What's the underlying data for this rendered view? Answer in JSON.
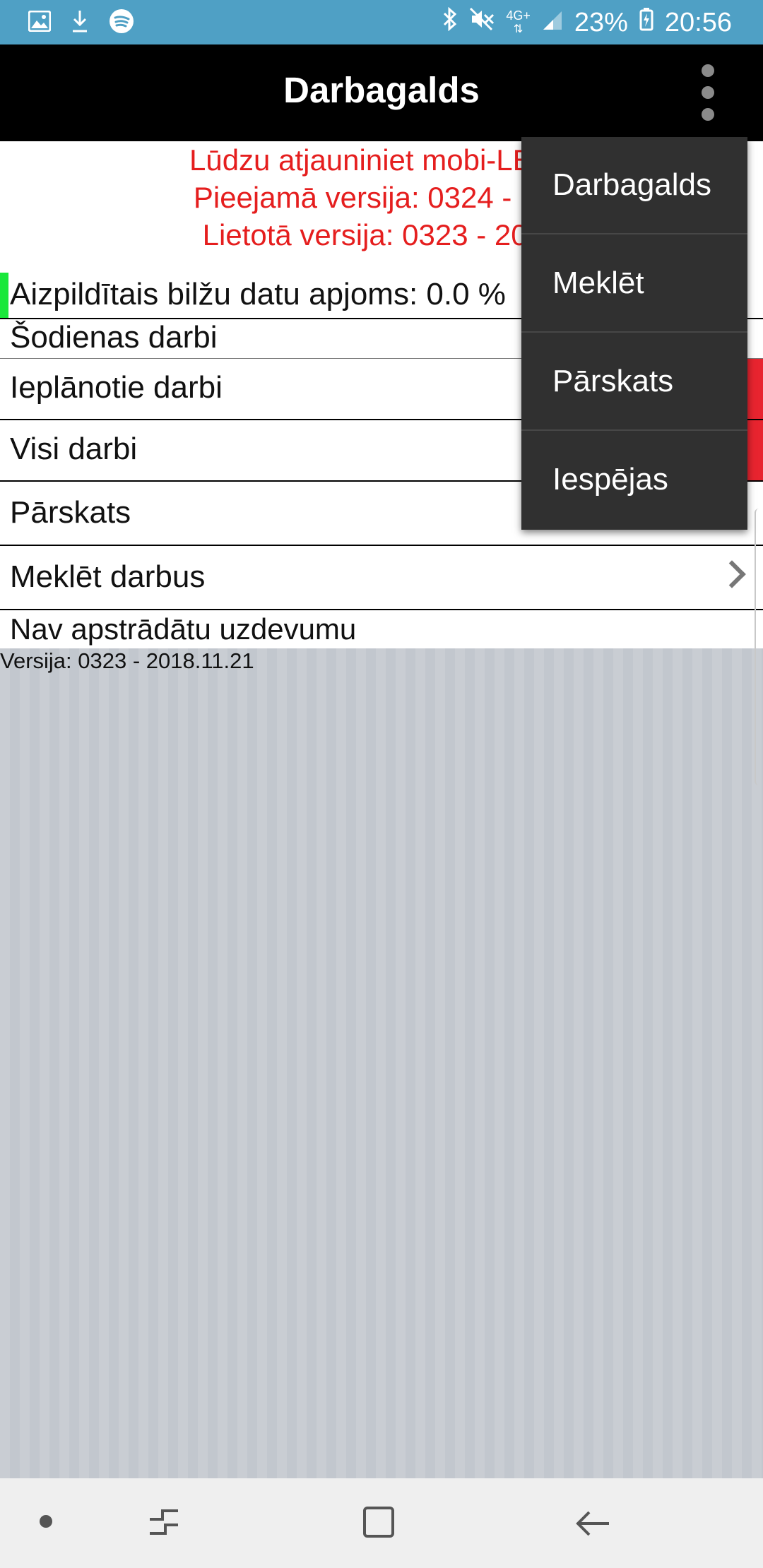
{
  "status_bar": {
    "battery": "23%",
    "time": "20:56",
    "network": "4G+",
    "icons_left": [
      "gallery-icon",
      "download-icon",
      "spotify-icon"
    ],
    "icons_right": [
      "bluetooth-icon",
      "mute-icon",
      "network-icon",
      "signal-icon",
      "battery-icon"
    ]
  },
  "app_bar": {
    "title": "Darbagalds"
  },
  "update_notice": {
    "line1": "Lūdzu atjauniniet mobi-LE ap",
    "line2": "Pieejamā versija: 0324 - 201",
    "line3": "Lietotā versija: 0323 - 2018",
    "color": "#e51e1e"
  },
  "dashboard": {
    "progress_label": "Aizpildītais bilžu datu apjoms: 0.0 %",
    "progress_percent": 0.0,
    "today_label": "Šodienas darbi",
    "planned_label": "Ieplānotie darbi",
    "all_label": "Visi darbi",
    "overview_label": "Pārskats",
    "search_label": "Meklēt darbus",
    "no_tasks_label": "Nav apstrādātu uzdevumu"
  },
  "footer": {
    "version": "Versija: 0323 - 2018.11.21"
  },
  "dropdown_menu": {
    "items": [
      {
        "label": "Darbagalds"
      },
      {
        "label": "Meklēt"
      },
      {
        "label": "Pārskats"
      },
      {
        "label": "Iespējas"
      }
    ]
  },
  "colors": {
    "status_bar": "#4fa0c5",
    "app_bar": "#000000",
    "accent_red": "#e8242f",
    "progress_green": "#19e83b",
    "menu_bg": "#303030"
  }
}
